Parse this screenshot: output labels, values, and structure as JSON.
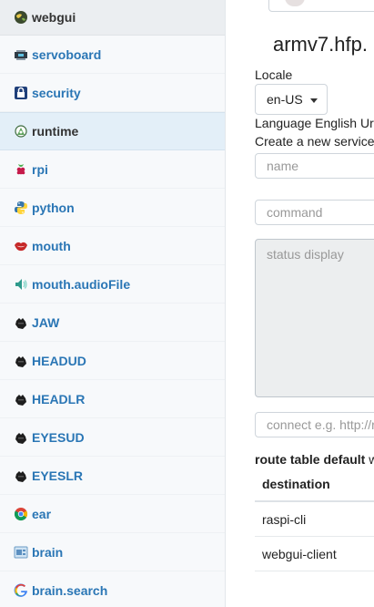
{
  "sidebar": {
    "items": [
      {
        "label": "webgui",
        "icon": "globe-icon"
      },
      {
        "label": "servoboard",
        "icon": "board-icon"
      },
      {
        "label": "security",
        "icon": "lock-icon"
      },
      {
        "label": "runtime",
        "icon": "runtime-icon"
      },
      {
        "label": "rpi",
        "icon": "raspberry-icon"
      },
      {
        "label": "python",
        "icon": "python-icon"
      },
      {
        "label": "mouth",
        "icon": "lips-icon"
      },
      {
        "label": "mouth.audioFile",
        "icon": "speaker-icon"
      },
      {
        "label": "JAW",
        "icon": "hand-icon"
      },
      {
        "label": "HEADUD",
        "icon": "hand-icon"
      },
      {
        "label": "HEADLR",
        "icon": "hand-icon"
      },
      {
        "label": "EYESUD",
        "icon": "hand-icon"
      },
      {
        "label": "EYESLR",
        "icon": "hand-icon"
      },
      {
        "label": "ear",
        "icon": "chrome-icon"
      },
      {
        "label": "brain",
        "icon": "brain-icon"
      },
      {
        "label": "brain.search",
        "icon": "google-icon"
      }
    ],
    "selected": "runtime"
  },
  "main": {
    "hostname": "armv7.hfp.",
    "locale_label": "Locale",
    "locale_value": "en-US",
    "language_line": "Language English Ur",
    "create_line": "Create a new service",
    "name_placeholder": "name",
    "command_placeholder": "command",
    "status_placeholder": "status display",
    "connect_placeholder": "connect e.g. http://r",
    "route_title": "route table default",
    "route_title_rest": "w",
    "route_table": {
      "header": "destination",
      "rows": [
        "raspi-cli",
        "webgui-client"
      ]
    }
  },
  "colors": {
    "link": "#2a76b5",
    "active_bg": "#e3eff8",
    "sidebar_bg": "#f7f9fb"
  }
}
